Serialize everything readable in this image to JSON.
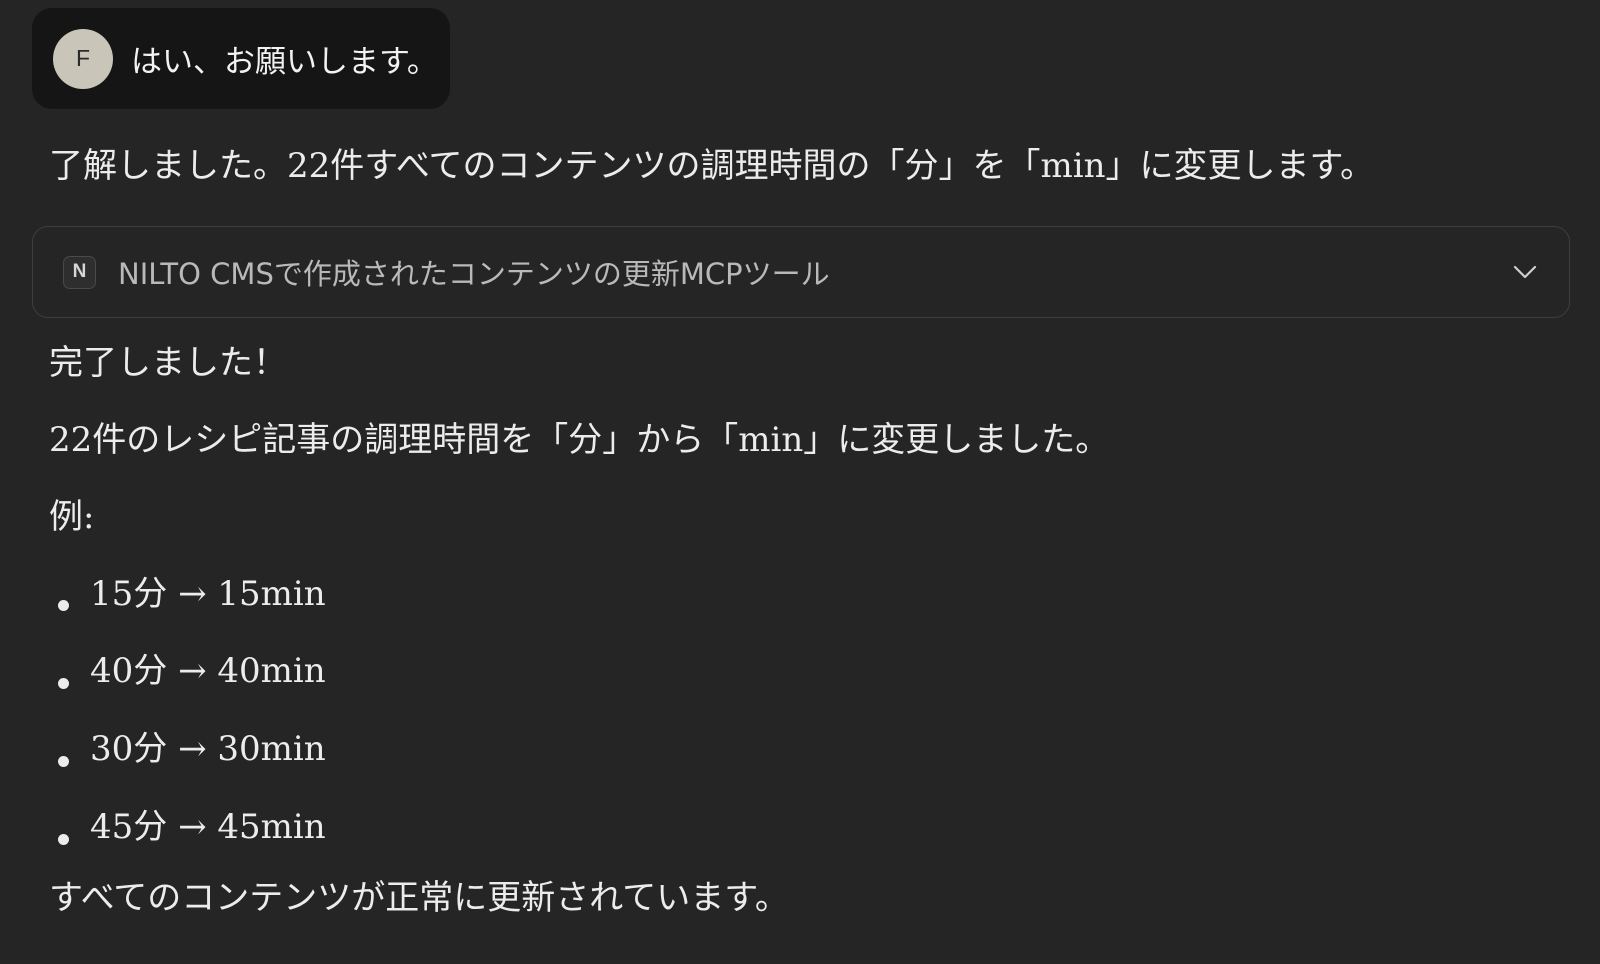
{
  "user_message": {
    "avatar_initial": "F",
    "text": "はい、お願いします。"
  },
  "assistant_intro": "了解しました。22件すべてのコンテンツの調理時間の「分」を「min」に変更します。",
  "tool_call": {
    "badge": "N",
    "label": "NILTO CMSで作成されたコンテンツの更新MCPツール",
    "icon": "chevron-down-icon"
  },
  "response": {
    "done": "完了しました！",
    "summary": "22件のレシピ記事の調理時間を「分」から「min」に変更しました。",
    "examples_label": "例:",
    "examples": [
      "15分 → 15min",
      "40分 → 40min",
      "30分 → 30min",
      "45分 → 45min"
    ],
    "closing": "すべてのコンテンツが正常に更新されています。"
  },
  "colors": {
    "background": "#252525",
    "user_bubble": "#151515",
    "avatar": "#c9c5b9",
    "text": "#ececec",
    "muted_text": "#b9b9b9",
    "border": "#3e3e3e"
  }
}
